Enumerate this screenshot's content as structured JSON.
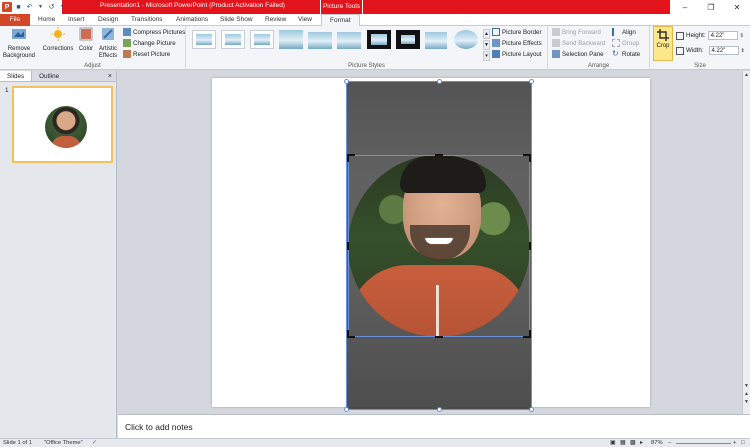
{
  "window": {
    "title": "Presentation1 - Microsoft PowerPoint (Product Activation Failed)",
    "context_tab": "Picture Tools"
  },
  "tabs": [
    "File",
    "Home",
    "Insert",
    "Design",
    "Transitions",
    "Animations",
    "Slide Show",
    "Review",
    "View",
    "Format"
  ],
  "ribbon": {
    "adjust": {
      "label": "Adjust",
      "remove_background": "Remove Background",
      "corrections": "Corrections",
      "color": "Color",
      "artistic_effects": "Artistic Effects",
      "compress": "Compress Pictures",
      "change": "Change Picture",
      "reset": "Reset Picture"
    },
    "picture_styles": {
      "label": "Picture Styles",
      "border": "Picture Border",
      "effects": "Picture Effects",
      "layout": "Picture Layout"
    },
    "arrange": {
      "label": "Arrange",
      "bring_forward": "Bring Forward",
      "send_backward": "Send Backward",
      "selection_pane": "Selection Pane",
      "align": "Align",
      "group": "Group",
      "rotate": "Rotate"
    },
    "size": {
      "label": "Size",
      "crop": "Crop",
      "height_label": "Height:",
      "height_value": "4.22\"",
      "width_label": "Width:",
      "width_value": "4.22\""
    }
  },
  "left_pane": {
    "tabs": [
      "Slides",
      "Outline"
    ],
    "close": "×",
    "slide_number": "1"
  },
  "notes_placeholder": "Click to add notes",
  "status": {
    "slide": "Slide 1 of 1",
    "theme": "\"Office Theme\"",
    "zoom": "87%"
  }
}
